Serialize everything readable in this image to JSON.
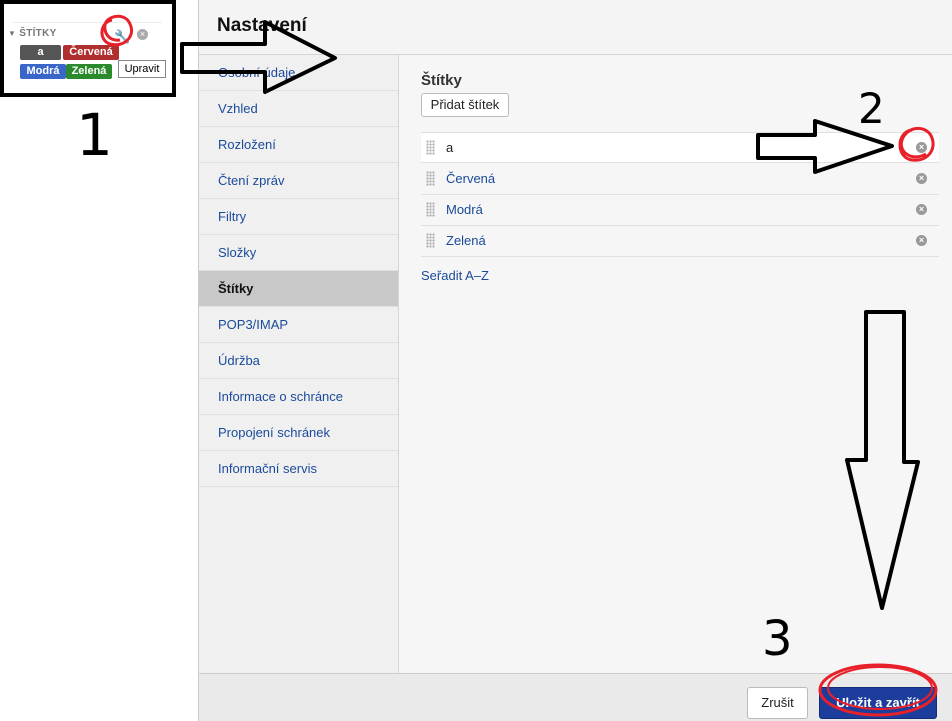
{
  "labels_widget": {
    "header": "ŠTÍTKY",
    "tags": [
      {
        "name": "a",
        "color": "#555555"
      },
      {
        "name": "Červená",
        "color": "#b03030"
      },
      {
        "name": "Modrá",
        "color": "#3b66c9"
      },
      {
        "name": "Zelená",
        "color": "#2b8a2b"
      }
    ],
    "edit_icon": "wrench-icon",
    "close_icon": "close-icon",
    "tooltip": "Upravit"
  },
  "dialog": {
    "title": "Nastavení",
    "nav": [
      "Osobní údaje",
      "Vzhled",
      "Rozložení",
      "Čtení zpráv",
      "Filtry",
      "Složky",
      "Štítky",
      "POP3/IMAP",
      "Údržba",
      "Informace o schránce",
      "Propojení schránek",
      "Informační servis"
    ],
    "active_nav": "Štítky",
    "section_title": "Štítky",
    "add_label_button": "Přidat štítek",
    "labels": [
      "a",
      "Červená",
      "Modrá",
      "Zelená"
    ],
    "sort_link": "Seřadit A–Z",
    "cancel_button": "Zrušit",
    "save_button": "Uložit a zavřít"
  },
  "annotations": {
    "step1": "1",
    "step2": "2",
    "step3": "3",
    "marker_color": "#e8202a"
  }
}
